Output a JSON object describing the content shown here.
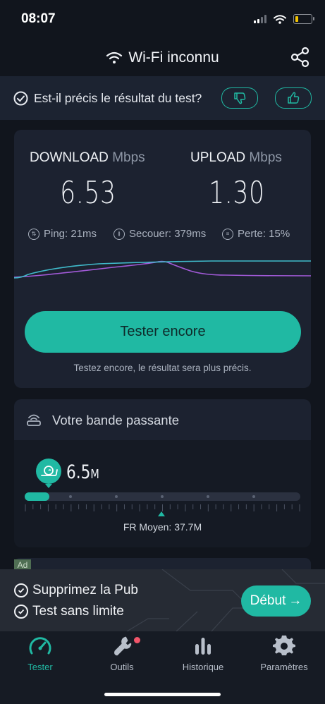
{
  "status": {
    "time": "08:07"
  },
  "header": {
    "title": "Wi-Fi inconnu",
    "icon": "wifi-icon",
    "share_icon": "share-icon"
  },
  "feedback": {
    "question": "Est-il précis le résultat du test?"
  },
  "results": {
    "download_label": "DOWNLOAD",
    "download_unit": "Mbps",
    "download_value": "6.53",
    "upload_label": "UPLOAD",
    "upload_unit": "Mbps",
    "upload_value": "1.30",
    "ping": "Ping: 21ms",
    "jitter": "Secouer: 379ms",
    "loss": "Perte: 15%",
    "colors": {
      "download_line": "#3fb9c9",
      "upload_line": "#a25ad8"
    }
  },
  "actions": {
    "retest_label": "Tester encore",
    "hint": "Testez encore, le résultat sera plus précis."
  },
  "bandwidth": {
    "title": "Votre bande passante",
    "value": "6.5",
    "value_unit": "M",
    "fill_fraction": 0.09,
    "average": "FR Moyen: 37.7M",
    "average_fraction": 0.5
  },
  "ad": {
    "badge": "Ad"
  },
  "promo": {
    "line1": "Supprimez la Pub",
    "line2": "Test sans limite",
    "cta": "Début",
    "cta_arrow": "→"
  },
  "tabs": [
    {
      "label": "Tester",
      "icon": "speedometer-icon",
      "active": true
    },
    {
      "label": "Outils",
      "icon": "wrench-icon",
      "notification": true
    },
    {
      "label": "Historique",
      "icon": "bar-chart-icon"
    },
    {
      "label": "Paramètres",
      "icon": "gear-icon"
    }
  ],
  "accent_color": "#20b9a3"
}
